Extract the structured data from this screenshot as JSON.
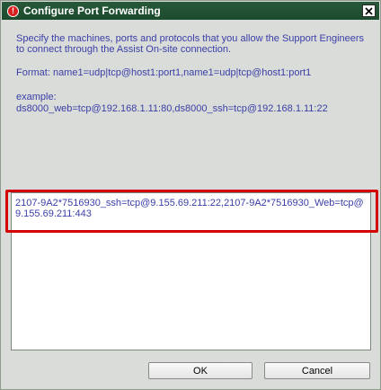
{
  "window": {
    "title": "Configure Port Forwarding",
    "icon": "error-icon",
    "close_icon": "close-icon"
  },
  "content": {
    "description": "Specify the machines, ports and protocols that you allow the Support Engineers to connect through the Assist On-site connection.",
    "format": "Format: name1=udp|tcp@host1:port1,name1=udp|tcp@host1:port1",
    "example_label": "example:",
    "example_value": "ds8000_web=tcp@192.168.1.11:80,ds8000_ssh=tcp@192.168.1.11:22"
  },
  "input": {
    "value": "2107-9A2*7516930_ssh=tcp@9.155.69.211:22,2107-9A2*7516930_Web=tcp@9.155.69.211:443"
  },
  "buttons": {
    "ok": "OK",
    "cancel": "Cancel"
  },
  "colors": {
    "titlebar": "#1c4a2c",
    "text": "#3a3fa8",
    "highlight": "#d20000",
    "background": "#d9dcd8"
  }
}
